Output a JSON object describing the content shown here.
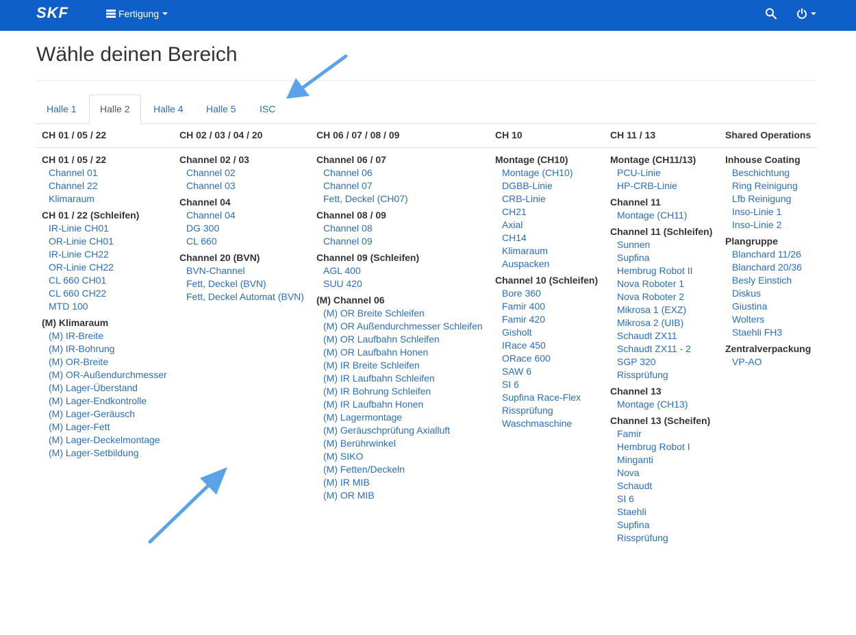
{
  "brand": "SKF",
  "navbar": {
    "menu_label": "Fertigung",
    "menu_icon": "list-icon",
    "search_icon": "search-icon",
    "power_icon": "power-icon",
    "bg_color": "#0f5fc9"
  },
  "page_title": "Wähle deinen Bereich",
  "tabs": [
    {
      "label": "Halle 1",
      "active": false
    },
    {
      "label": "Halle 2",
      "active": true
    },
    {
      "label": "Halle 4",
      "active": false
    },
    {
      "label": "Halle 5",
      "active": false
    },
    {
      "label": "ISC",
      "active": false
    }
  ],
  "columns": [
    {
      "header": "CH 01 / 05 / 22",
      "groups": [
        {
          "title": "CH 01 / 05 / 22",
          "items": [
            "Channel 01",
            "Channel 22",
            "Klimaraum"
          ]
        },
        {
          "title": "CH 01 / 22 (Schleifen)",
          "items": [
            "IR-Linie CH01",
            "OR-Linie CH01",
            "IR-Linie CH22",
            "OR-Linie CH22",
            "CL 660 CH01",
            "CL 660 CH22",
            "MTD 100"
          ]
        },
        {
          "title": "(M) Klimaraum",
          "items": [
            "(M) IR-Breite",
            "(M) IR-Bohrung",
            "(M) OR-Breite",
            "(M) OR-Außendurchmesser",
            "(M) Lager-Überstand",
            "(M) Lager-Endkontrolle",
            "(M) Lager-Geräusch",
            "(M) Lager-Fett",
            "(M) Lager-Deckelmontage",
            "(M) Lager-Setbildung"
          ]
        }
      ]
    },
    {
      "header": "CH 02 / 03 / 04 / 20",
      "groups": [
        {
          "title": "Channel 02 / 03",
          "items": [
            "Channel 02",
            "Channel 03"
          ]
        },
        {
          "title": "Channel 04",
          "items": [
            "Channel 04",
            "DG 300",
            "CL 660"
          ]
        },
        {
          "title": "Channel 20 (BVN)",
          "items": [
            "BVN-Channel",
            "Fett, Deckel (BVN)",
            "Fett, Deckel Automat (BVN)"
          ]
        }
      ]
    },
    {
      "header": "CH 06 / 07 / 08 / 09",
      "groups": [
        {
          "title": "Channel 06 / 07",
          "items": [
            "Channel 06",
            "Channel 07",
            "Fett, Deckel (CH07)"
          ]
        },
        {
          "title": "Channel 08 / 09",
          "items": [
            "Channel 08",
            "Channel 09"
          ]
        },
        {
          "title": "Channel 09 (Schleifen)",
          "items": [
            "AGL 400",
            "SUU 420"
          ]
        },
        {
          "title": "(M) Channel 06",
          "items": [
            "(M) OR Breite Schleifen",
            "(M) OR Außendurchmesser Schleifen",
            "(M) OR Laufbahn Schleifen",
            "(M) OR Laufbahn Honen",
            "(M) IR Breite Schleifen",
            "(M) IR Laufbahn Schleifen",
            "(M) IR Bohrung Schleifen",
            "(M) IR Laufbahn Honen",
            "(M) Lagermontage",
            "(M) Geräuschprüfung Axialluft",
            "(M) Berührwinkel",
            "(M) SIKO",
            "(M) Fetten/Deckeln",
            "(M) IR MIB",
            "(M) OR MIB"
          ]
        }
      ]
    },
    {
      "header": "CH 10",
      "groups": [
        {
          "title": "Montage (CH10)",
          "items": [
            "Montage (CH10)",
            "DGBB-Linie",
            "CRB-Linie",
            "CH21",
            "Axial",
            "CH14",
            "Klimaraum",
            "Auspacken"
          ]
        },
        {
          "title": "Channel 10 (Schleifen)",
          "items": [
            "Bore 360",
            "Famir 400",
            "Famir 420",
            "Gisholt",
            "IRace 450",
            "ORace 600",
            "SAW 6",
            "SI 6",
            "Supfina Race-Flex",
            "Rissprüfung",
            "Waschmaschine"
          ]
        }
      ]
    },
    {
      "header": "CH 11 / 13",
      "groups": [
        {
          "title": "Montage (CH11/13)",
          "items": [
            "PCU-Linie",
            "HP-CRB-Linie"
          ]
        },
        {
          "title": "Channel 11",
          "items": [
            "Montage (CH11)"
          ]
        },
        {
          "title": "Channel 11 (Schleifen)",
          "items": [
            "Sunnen",
            "Supfina",
            "Hembrug Robot II",
            "Nova Roboter 1",
            "Nova Roboter 2",
            "Mikrosa 1 (EXZ)",
            "Mikrosa 2 (UIB)",
            "Schaudt ZX11",
            "Schaudt ZX11 - 2",
            "SGP 320",
            "Rissprüfung"
          ]
        },
        {
          "title": "Channel 13",
          "items": [
            "Montage (CH13)"
          ]
        },
        {
          "title": "Channel 13 (Scheifen)",
          "items": [
            "Famir",
            "Hembrug Robot I",
            "Minganti",
            "Nova",
            "Schaudt",
            "SI 6",
            "Staehli",
            "Supfina",
            "Rissprüfung"
          ]
        }
      ]
    },
    {
      "header": "Shared Operations",
      "groups": [
        {
          "title": "Inhouse Coating",
          "items": [
            "Beschichtung",
            "Ring Reinigung",
            "Lfb Reinigung",
            "Inso-Linie 1",
            "Inso-Linie 2"
          ]
        },
        {
          "title": "Plangruppe",
          "items": [
            "Blanchard 11/26",
            "Blanchard 20/36",
            "Besly Einstich",
            "Diskus",
            "Giustina",
            "Wolters",
            "Staehli FH3"
          ]
        },
        {
          "title": "Zentralverpackung",
          "items": [
            "VP-AO"
          ]
        }
      ]
    }
  ],
  "colors": {
    "link": "#2a6ebb",
    "arrow": "#5aa3e8"
  }
}
